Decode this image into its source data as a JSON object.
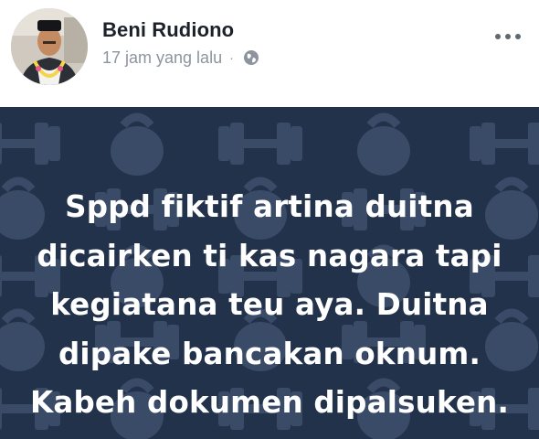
{
  "post": {
    "author": "Beni Rudiono",
    "timestamp": "17 jam yang lalu",
    "separator": "·",
    "privacy_icon": "globe-icon",
    "menu_icon": "more-options-icon",
    "background_pattern": "kettlebell-dumbbell-pattern",
    "background_color": "#22324b",
    "text_lines": [
      "Sppd fiktif artina duitna",
      "dicairken ti kas nagara tapi",
      "kegiatana teu aya. Duitna",
      "dipake bancakan oknum.",
      "Kabeh dokumen dipalsuken."
    ]
  }
}
